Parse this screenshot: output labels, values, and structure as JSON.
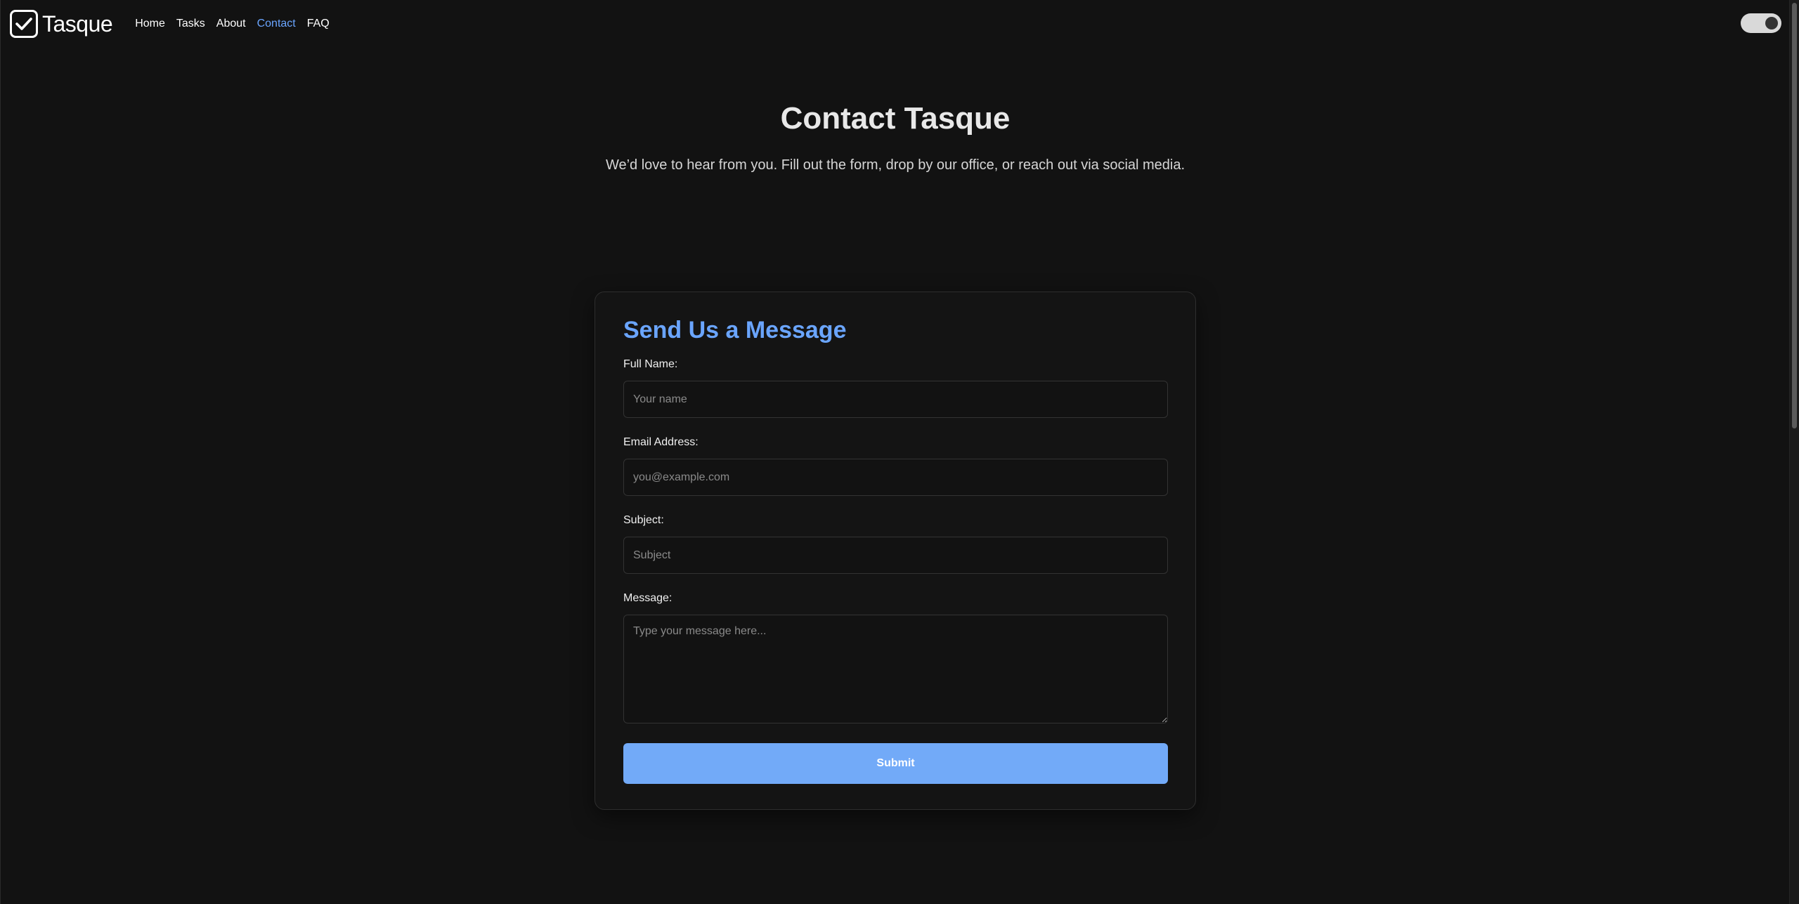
{
  "nav": {
    "brand": "Tasque",
    "links": [
      {
        "label": "Home",
        "active": false
      },
      {
        "label": "Tasks",
        "active": false
      },
      {
        "label": "About",
        "active": false
      },
      {
        "label": "Contact",
        "active": true
      },
      {
        "label": "FAQ",
        "active": false
      }
    ],
    "theme_toggle": "on"
  },
  "hero": {
    "title": "Contact Tasque",
    "subtitle": "We’d love to hear from you. Fill out the form, drop by our office, or reach out via social media."
  },
  "form": {
    "title": "Send Us a Message",
    "fields": {
      "name": {
        "label": "Full Name:",
        "placeholder": "Your name",
        "value": ""
      },
      "email": {
        "label": "Email Address:",
        "placeholder": "you@example.com",
        "value": ""
      },
      "subject": {
        "label": "Subject:",
        "placeholder": "Subject",
        "value": ""
      },
      "message": {
        "label": "Message:",
        "placeholder": "Type your message here...",
        "value": ""
      }
    },
    "submit_label": "Submit"
  },
  "colors": {
    "background": "#121212",
    "accent": "#6aa5ff",
    "button": "#72aaf8"
  },
  "icons": {
    "logo": "checkbox-check-icon"
  }
}
